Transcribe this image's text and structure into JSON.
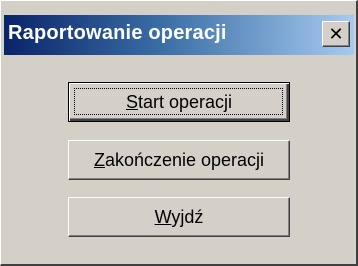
{
  "window": {
    "title": "Raportowanie operacji",
    "close_glyph": "✕",
    "colors": {
      "titlebar_start": "#0a246a",
      "titlebar_end": "#a6caf0",
      "face": "#d4d0c8"
    }
  },
  "buttons": [
    {
      "accelerator": "S",
      "label_rest": "tart operacji",
      "label": "Start operacji",
      "is_default": true
    },
    {
      "accelerator": "Z",
      "label_rest": "akończenie operacji",
      "label": "Zakończenie operacji",
      "is_default": false
    },
    {
      "accelerator": "W",
      "label_rest": "yjdź",
      "label": "Wyjdź",
      "is_default": false
    }
  ],
  "icons": {
    "close": "close-icon"
  }
}
